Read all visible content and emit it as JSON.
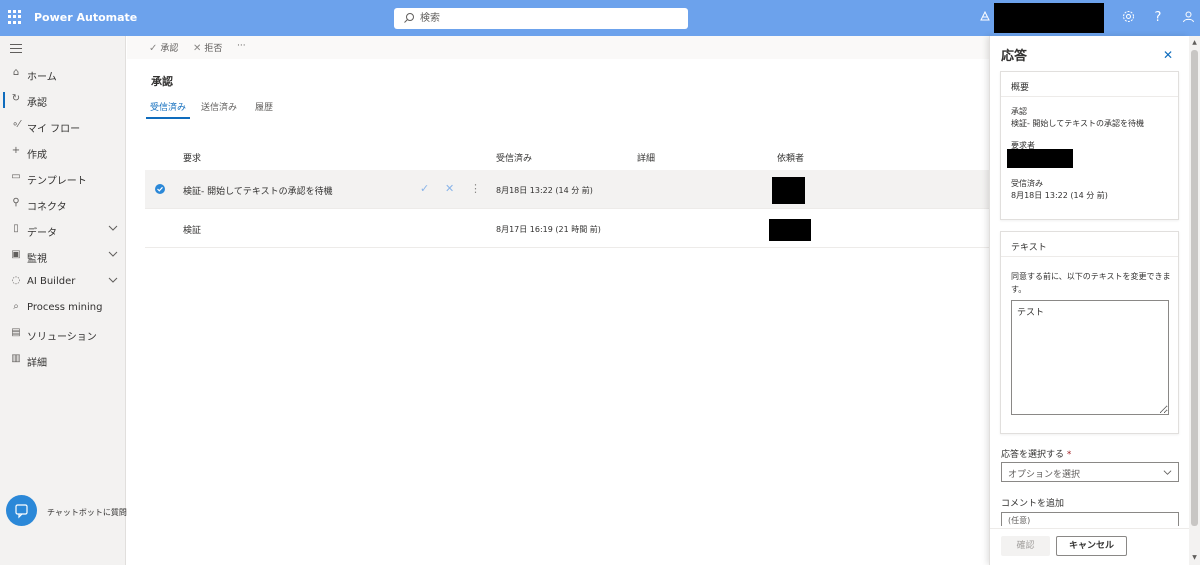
{
  "header": {
    "app_name": "Power Automate",
    "search_placeholder": "検索"
  },
  "sidebar": {
    "items": [
      {
        "label": "ホーム",
        "icon": "home-icon"
      },
      {
        "label": "承認",
        "icon": "approvals-icon",
        "active": true
      },
      {
        "label": "マイ フロー",
        "icon": "flows-icon"
      },
      {
        "label": "作成",
        "icon": "plus-icon"
      },
      {
        "label": "テンプレート",
        "icon": "template-icon"
      },
      {
        "label": "コネクタ",
        "icon": "connector-icon"
      },
      {
        "label": "データ",
        "icon": "database-icon",
        "expandable": true
      },
      {
        "label": "監視",
        "icon": "monitor-icon",
        "expandable": true
      },
      {
        "label": "AI Builder",
        "icon": "ai-builder-icon",
        "expandable": true
      },
      {
        "label": "Process mining",
        "icon": "process-mining-icon"
      },
      {
        "label": "ソリューション",
        "icon": "solution-icon"
      },
      {
        "label": "詳細",
        "icon": "book-icon"
      }
    ],
    "chatbot_label": "チャットボットに質問"
  },
  "commandbar": {
    "approve_label": "承認",
    "reject_label": "拒否",
    "more_label": "···"
  },
  "main": {
    "page_title": "承認",
    "tabs": [
      {
        "label": "受信済み",
        "active": true
      },
      {
        "label": "送信済み"
      },
      {
        "label": "履歴"
      }
    ],
    "columns": {
      "request": "要求",
      "received": "受信済み",
      "details": "詳細",
      "requester": "依頼者"
    },
    "rows": [
      {
        "title": "検証- 開始してテキストの承認を待機",
        "received": "8月18日 13:22 (14 分 前)",
        "selected": true
      },
      {
        "title": "検証",
        "received": "8月17日 16:19 (21 時間 前)",
        "selected": false
      }
    ]
  },
  "panel": {
    "title": "応答",
    "summary": {
      "header": "概要",
      "approval_label": "承認",
      "approval_value": "検証- 開始してテキストの承認を待機",
      "requester_label": "要求者",
      "received_label": "受信済み",
      "received_value": "8月18日 13:22 (14 分 前)"
    },
    "text_card": {
      "header": "テキスト",
      "description": "同意する前に、以下のテキストを変更できます。",
      "value": "テスト"
    },
    "response_label": "応答を選択する",
    "response_required": "*",
    "response_placeholder": "オプションを選択",
    "comment_label": "コメントを追加",
    "comment_placeholder": "(任意)",
    "confirm_label": "確認",
    "cancel_label": "キャンセル"
  }
}
